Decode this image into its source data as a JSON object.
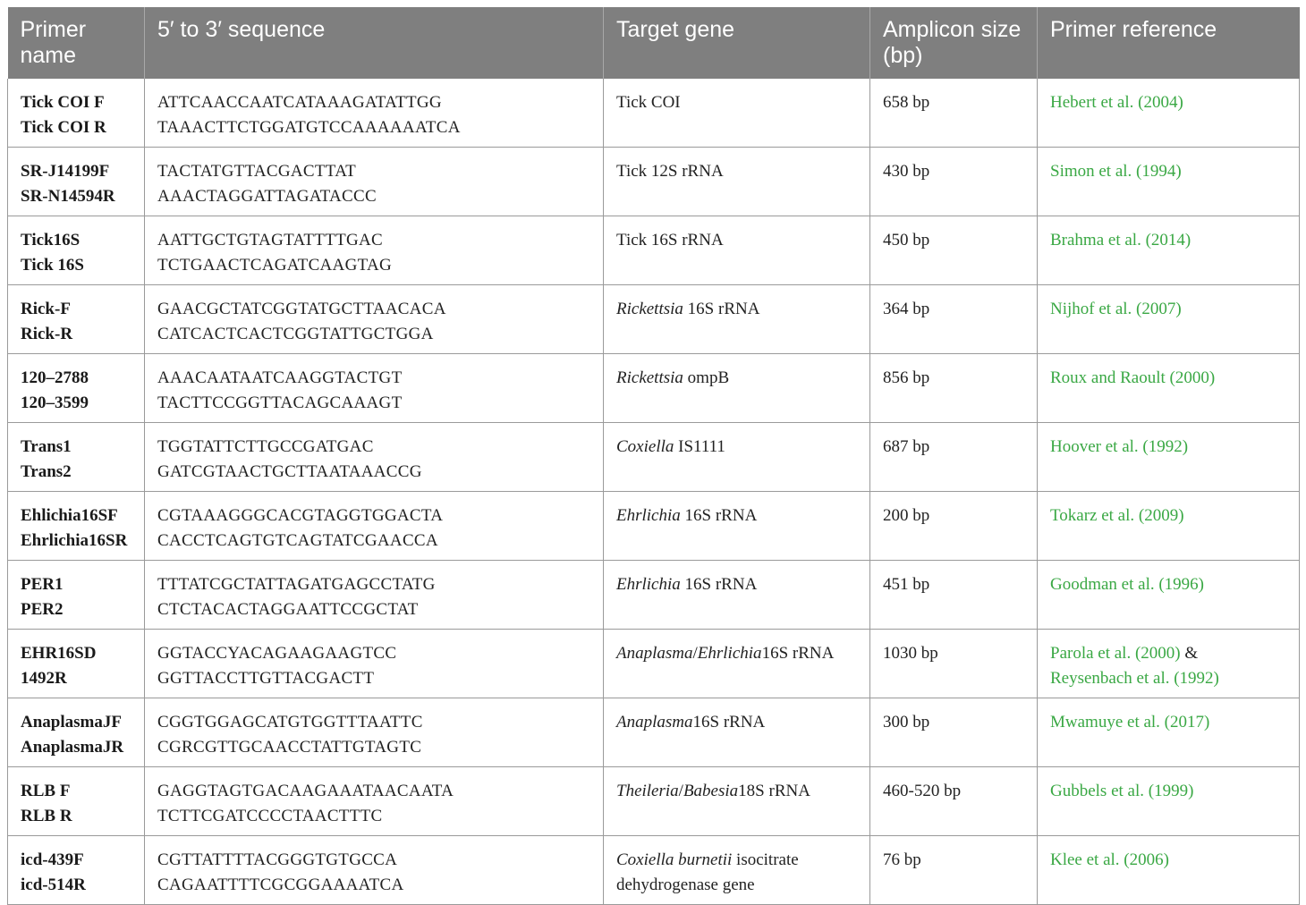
{
  "header": {
    "primer_name": "Primer name",
    "sequence": "5′ to 3′ sequence",
    "target_gene": "Target gene",
    "amplicon_size": "Amplicon size (bp)",
    "primer_reference": "Primer reference"
  },
  "rows": [
    {
      "primer": [
        "Tick COI F",
        "Tick COI R"
      ],
      "sequence": [
        "ATTCAACCAATCATAAAGATATTGG",
        "TAAACTTCTGGATGTCCAAAAAATCA"
      ],
      "target": [
        [
          {
            "t": "Tick COI",
            "i": false
          }
        ]
      ],
      "amplicon": "658 bp",
      "reference": [
        "Hebert et al. (2004)"
      ]
    },
    {
      "primer": [
        "SR-J14199F",
        "SR-N14594R"
      ],
      "sequence": [
        "TACTATGTTACGACTTAT",
        "AAACTAGGATTAGATACCC"
      ],
      "target": [
        [
          {
            "t": "Tick 12S rRNA",
            "i": false
          }
        ]
      ],
      "amplicon": "430 bp",
      "reference": [
        "Simon et al. (1994)"
      ]
    },
    {
      "primer": [
        "Tick16S",
        "Tick 16S"
      ],
      "sequence": [
        "AATTGCTGTAGTATTTTGAC",
        "TCTGAACTCAGATCAAGTAG"
      ],
      "target": [
        [
          {
            "t": "Tick 16S rRNA",
            "i": false
          }
        ]
      ],
      "amplicon": "450 bp",
      "reference": [
        "Brahma et al. (2014)"
      ]
    },
    {
      "primer": [
        "Rick-F",
        "Rick-R"
      ],
      "sequence": [
        "GAACGCTATCGGTATGCTTAACACA",
        "CATCACTCACTCGGTATTGCTGGA"
      ],
      "target": [
        [
          {
            "t": "Rickettsia",
            "i": true
          },
          {
            "t": " 16S rRNA",
            "i": false
          }
        ]
      ],
      "amplicon": "364 bp",
      "reference": [
        "Nijhof et al. (2007)"
      ]
    },
    {
      "primer": [
        "120–2788",
        "120–3599"
      ],
      "sequence": [
        "AAACAATAATCAAGGTACTGT",
        "TACTTCCGGTTACAGCAAAGT"
      ],
      "target": [
        [
          {
            "t": "Rickettsia",
            "i": true
          },
          {
            "t": " ompB",
            "i": false
          }
        ]
      ],
      "amplicon": "856 bp",
      "reference": [
        "Roux and Raoult (2000)"
      ]
    },
    {
      "primer": [
        "Trans1",
        "Trans2"
      ],
      "sequence": [
        "TGGTATTCTTGCCGATGAC",
        "GATCGTAACTGCTTAATAAACCG"
      ],
      "target": [
        [
          {
            "t": "Coxiella",
            "i": true
          },
          {
            "t": " IS1111",
            "i": false
          }
        ]
      ],
      "amplicon": "687 bp",
      "reference": [
        "Hoover et al. (1992)"
      ]
    },
    {
      "primer": [
        "Ehlichia16SF",
        "Ehrlichia16SR"
      ],
      "sequence": [
        "CGTAAAGGGCACGTAGGTGGACTA",
        "CACCTCAGTGTCAGTATCGAACCA"
      ],
      "target": [
        [
          {
            "t": "Ehrlichia",
            "i": true
          },
          {
            "t": " 16S rRNA",
            "i": false
          }
        ]
      ],
      "amplicon": "200 bp",
      "reference": [
        "Tokarz et al. (2009)"
      ]
    },
    {
      "primer": [
        "PER1",
        "PER2"
      ],
      "sequence": [
        "TTTATCGCTATTAGATGAGCCTATG",
        "CTCTACACTAGGAATTCCGCTAT"
      ],
      "target": [
        [
          {
            "t": "Ehrlichia",
            "i": true
          },
          {
            "t": " 16S rRNA",
            "i": false
          }
        ]
      ],
      "amplicon": "451 bp",
      "reference": [
        "Goodman et al. (1996)"
      ]
    },
    {
      "primer": [
        "EHR16SD",
        "1492R"
      ],
      "sequence": [
        "GGTACCYACAGAAGAAGTCC",
        "GGTTACCTTGTTACGACTT"
      ],
      "target": [
        [
          {
            "t": "Anaplasma",
            "i": true
          },
          {
            "t": "/",
            "i": false
          },
          {
            "t": "Ehrlichia",
            "i": true
          },
          {
            "t": "16S rRNA",
            "i": false
          }
        ]
      ],
      "amplicon": "1030 bp",
      "reference": [
        "Parola et al. (2000)",
        "Reysenbach et al. (1992)"
      ],
      "reference_join": " &"
    },
    {
      "primer": [
        "AnaplasmaJF",
        "AnaplasmaJR"
      ],
      "sequence": [
        "CGGTGGAGCATGTGGTTTAATTC",
        "CGRCGTTGCAACCTATTGTAGTC"
      ],
      "target": [
        [
          {
            "t": "Anaplasma",
            "i": true
          },
          {
            "t": "16S rRNA",
            "i": false
          }
        ]
      ],
      "amplicon": "300 bp",
      "reference": [
        "Mwamuye et al. (2017)"
      ]
    },
    {
      "primer": [
        "RLB F",
        "RLB R"
      ],
      "sequence": [
        "GAGGTAGTGACAAGAAATAACAATA",
        "TCTTCGATCCCCTAACTTTC"
      ],
      "target": [
        [
          {
            "t": "Theileria",
            "i": true
          },
          {
            "t": "/",
            "i": false
          },
          {
            "t": "Babesia",
            "i": true
          },
          {
            "t": "18S rRNA",
            "i": false
          }
        ]
      ],
      "amplicon": "460-520 bp",
      "reference": [
        "Gubbels et al. (1999)"
      ]
    },
    {
      "primer": [
        "icd-439F",
        "icd-514R"
      ],
      "sequence": [
        "CGTTATTTTACGGGTGTGCCA",
        "CAGAATTTTCGCGGAAAATCA"
      ],
      "target": [
        [
          {
            "t": "Coxiella burnetii",
            "i": true
          },
          {
            "t": " isocitrate",
            "i": false
          }
        ],
        [
          {
            "t": "dehydrogenase gene",
            "i": false
          }
        ]
      ],
      "amplicon": "76 bp",
      "reference": [
        "Klee et al. (2006)"
      ]
    }
  ],
  "colors": {
    "header_bg": "#7f7f7f",
    "header_text": "#ffffff",
    "reference_link": "#3aa844",
    "border": "#9a9a9a"
  }
}
